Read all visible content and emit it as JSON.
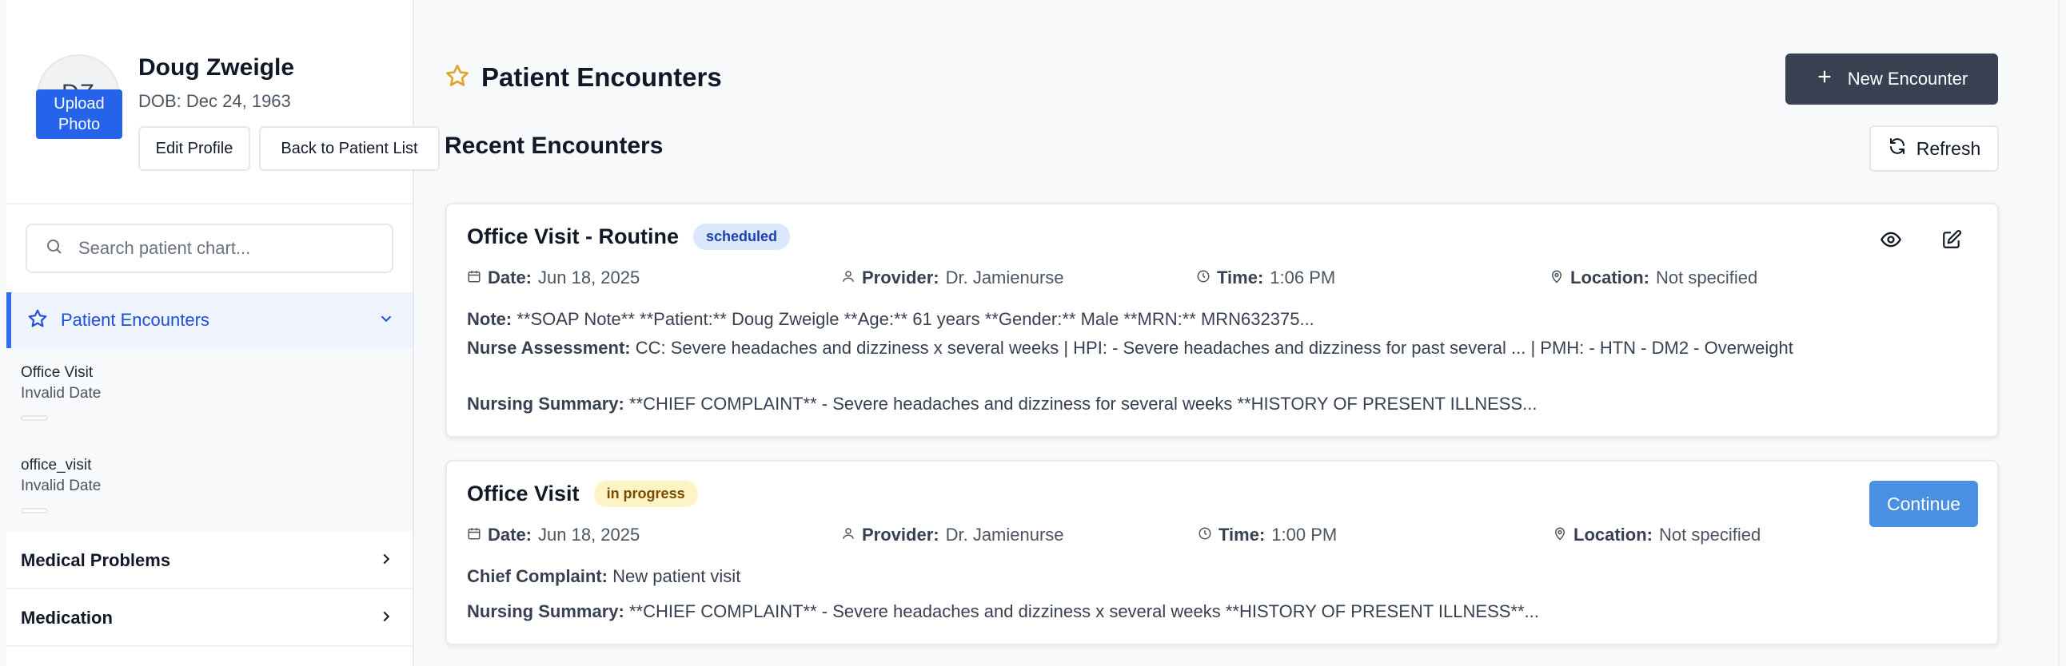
{
  "patient": {
    "initials": "DZ",
    "upload_label": "Upload Photo",
    "name": "Doug Zweigle",
    "dob": "DOB: Dec 24, 1963",
    "edit_label": "Edit Profile",
    "back_label": "Back to Patient List"
  },
  "search": {
    "placeholder": "Search patient chart..."
  },
  "sidebar": {
    "active_section": "Patient Encounters",
    "encounter_items": [
      {
        "title": "Office Visit",
        "date": "Invalid Date"
      },
      {
        "title": "office_visit",
        "date": "Invalid Date"
      }
    ],
    "sections": [
      "Medical Problems",
      "Medication"
    ]
  },
  "header": {
    "title": "Patient Encounters",
    "new_label": "New Encounter",
    "recent_title": "Recent Encounters",
    "refresh_label": "Refresh"
  },
  "labels": {
    "date": "Date:",
    "provider": "Provider:",
    "time": "Time:",
    "location": "Location:",
    "note": "Note:",
    "nurse_assessment": "Nurse Assessment:",
    "nursing_summary": "Nursing Summary:",
    "chief_complaint": "Chief Complaint:"
  },
  "encounters": [
    {
      "title": "Office Visit - Routine",
      "status": "scheduled",
      "date": "Jun 18, 2025",
      "provider": "Dr. Jamienurse",
      "time": "1:06 PM",
      "location": "Not specified",
      "note": "**SOAP Note** **Patient:** Doug Zweigle **Age:** 61 years **Gender:** Male **MRN:** MRN632375...",
      "nurse_assessment": "CC: Severe headaches and dizziness x several weeks | HPI: - Severe headaches and dizziness for past several ... | PMH: - HTN - DM2 - Overweight",
      "nursing_summary": "**CHIEF COMPLAINT** - Severe headaches and dizziness for several weeks **HISTORY OF PRESENT ILLNESS..."
    },
    {
      "title": "Office Visit",
      "status": "in progress",
      "date": "Jun 18, 2025",
      "provider": "Dr. Jamienurse",
      "time": "1:00 PM",
      "location": "Not specified",
      "chief_complaint": "New patient visit",
      "nursing_summary": "**CHIEF COMPLAINT** - Severe headaches and dizziness x several weeks **HISTORY OF PRESENT ILLNESS**...",
      "continue_label": "Continue"
    }
  ],
  "colors": {
    "accent": "#2563eb",
    "dark_button": "#374151",
    "continue_button": "#4a90e2",
    "star": "#e0a526"
  }
}
